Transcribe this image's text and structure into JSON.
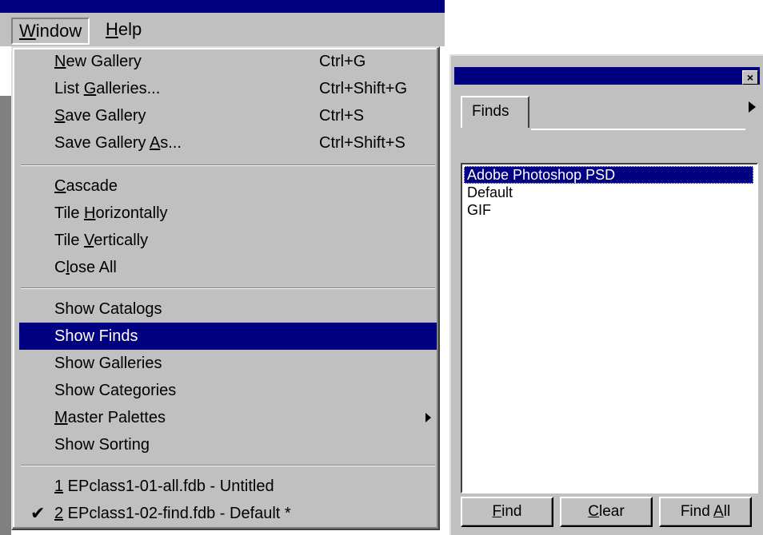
{
  "menubar": {
    "window_label": "Window",
    "help_label": "Help"
  },
  "dropdown": {
    "items": [
      {
        "label": "New Gallery",
        "shortcut": "Ctrl+G"
      },
      {
        "label": "List Galleries...",
        "shortcut": "Ctrl+Shift+G"
      },
      {
        "label": "Save Gallery",
        "shortcut": "Ctrl+S"
      },
      {
        "label": "Save Gallery As...",
        "shortcut": "Ctrl+Shift+S"
      },
      {
        "label": "Cascade"
      },
      {
        "label": "Tile Horizontally"
      },
      {
        "label": "Tile Vertically"
      },
      {
        "label": "Close All"
      },
      {
        "label": "Show Catalogs"
      },
      {
        "label": "Show Finds",
        "highlighted": true
      },
      {
        "label": "Show Galleries"
      },
      {
        "label": "Show Categories"
      },
      {
        "label": "Master Palettes",
        "submenu": true
      },
      {
        "label": "Show Sorting"
      },
      {
        "label": "1 EPclass1-01-all.fdb - Untitled"
      },
      {
        "label": "2 EPclass1-02-find.fdb - Default *",
        "checked": true
      }
    ],
    "check_glyph": "✔"
  },
  "palette": {
    "close_glyph": "×",
    "tab_label": "Finds",
    "list_items": [
      "Adobe Photoshop PSD",
      "Default",
      "GIF"
    ],
    "selected_index": 0,
    "buttons": {
      "find": "Find",
      "clear": "Clear",
      "find_all": "Find All"
    }
  },
  "colors": {
    "highlight": "#000080",
    "face": "#c0c0c0"
  }
}
